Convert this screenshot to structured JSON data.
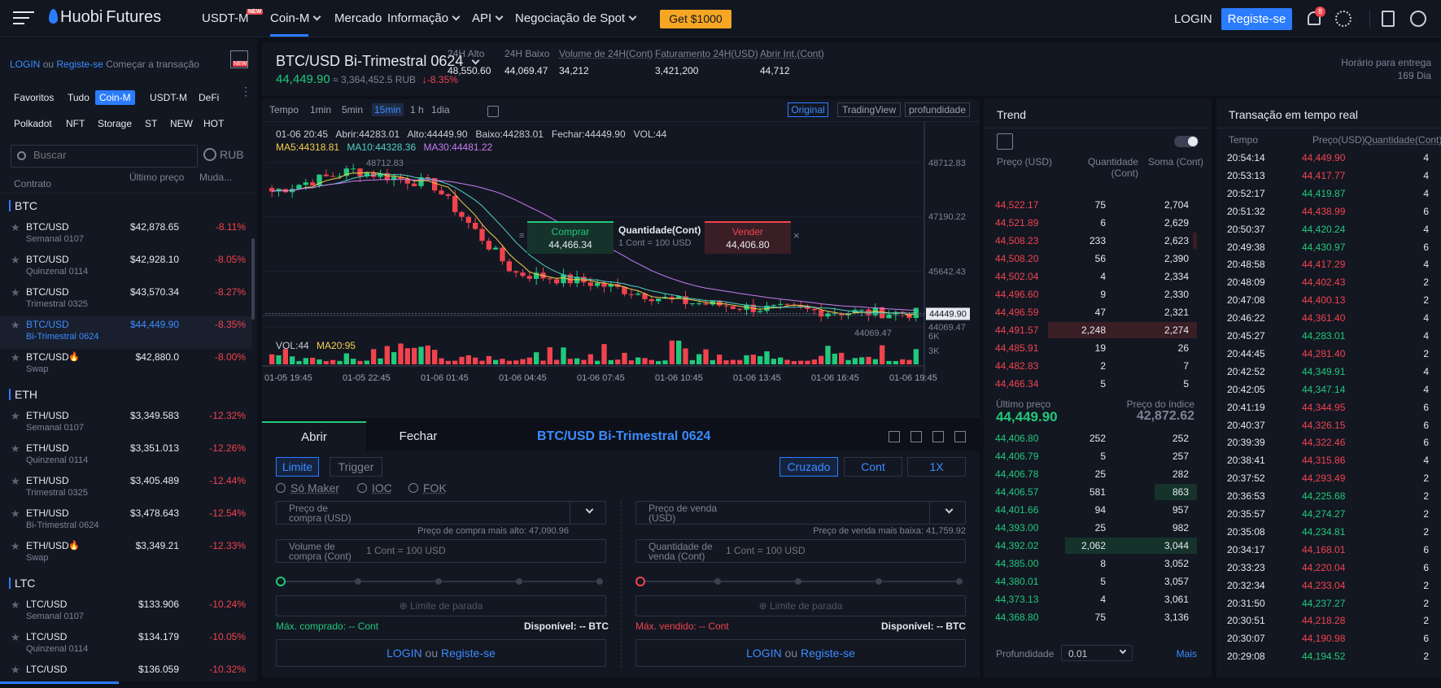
{
  "brand": {
    "logo_huobi": "Huobi",
    "logo_futures": "Futures"
  },
  "nav": {
    "usdt_m": "USDT-M",
    "new_tag": "NEW",
    "coin_m": "Coin-M",
    "mercado": "Mercado",
    "informacao": "Informação",
    "api": "API",
    "spot": "Negociação de Spot",
    "promo": "Get $1000",
    "login": "LOGIN",
    "register": "Registe-se",
    "notif_count": "8"
  },
  "left": {
    "login_link": "LOGIN",
    "or": "ou",
    "register_link": "Registe-se",
    "start": "Começar a transação",
    "new_badge": "NEW",
    "tabs1": [
      "Favoritos",
      "Tudo",
      "Coin-M",
      "USDT-M",
      "DeFi"
    ],
    "tabs2": [
      "Polkadot",
      "NFT",
      "Storage",
      "ST",
      "NEW",
      "HOT"
    ],
    "search_placeholder": "Buscar",
    "currency": "RUB",
    "col_price": "Último preço",
    "col_change": "Muda...",
    "col_contract": "Contrato",
    "groups": [
      {
        "name": "BTC",
        "rows": [
          {
            "n1": "BTC/USD",
            "n2": "Semanal 0107",
            "price": "$42,878.65",
            "change": "-8.11%"
          },
          {
            "n1": "BTC/USD",
            "n2": "Quinzenal 0114",
            "price": "$42,928.10",
            "change": "-8.05%"
          },
          {
            "n1": "BTC/USD",
            "n2": "Trimestral 0325",
            "price": "$43,570.34",
            "change": "-8.27%"
          },
          {
            "n1": "BTC/USD",
            "n2": "Bi-Trimestral 0624",
            "price": "$44,449.90",
            "change": "-8.35%"
          },
          {
            "n1": "BTC/USD",
            "n2": "Swap",
            "price": "$42,880.0",
            "change": "-8.00%"
          }
        ]
      },
      {
        "name": "ETH",
        "rows": [
          {
            "n1": "ETH/USD",
            "n2": "Semanal 0107",
            "price": "$3,349.583",
            "change": "-12.32%"
          },
          {
            "n1": "ETH/USD",
            "n2": "Quinzenal 0114",
            "price": "$3,351.013",
            "change": "-12.26%"
          },
          {
            "n1": "ETH/USD",
            "n2": "Trimestral 0325",
            "price": "$3,405.489",
            "change": "-12.44%"
          },
          {
            "n1": "ETH/USD",
            "n2": "Bi-Trimestral 0624",
            "price": "$3,478.643",
            "change": "-12.54%"
          },
          {
            "n1": "ETH/USD",
            "n2": "Swap",
            "price": "$3,349.21",
            "change": "-12.33%"
          }
        ]
      },
      {
        "name": "LTC",
        "rows": [
          {
            "n1": "LTC/USD",
            "n2": "Semanal 0107",
            "price": "$133.906",
            "change": "-10.24%"
          },
          {
            "n1": "LTC/USD",
            "n2": "Quinzenal 0114",
            "price": "$134.179",
            "change": "-10.05%"
          },
          {
            "n1": "LTC/USD",
            "n2": "",
            "price": "$136.059",
            "change": "-10.32%"
          }
        ]
      }
    ]
  },
  "header": {
    "symbol": "BTC/USD Bi-Trimestral 0624",
    "price": "44,449.90",
    "rub": "≈ 3,364,452.5 RUB",
    "change": "-8.35%",
    "stats": [
      {
        "label": "24H Alto",
        "value": "48,550.60"
      },
      {
        "label": "24H Baixo",
        "value": "44,069.47"
      },
      {
        "label": "Volume de 24H(Cont)",
        "value": "34,212"
      },
      {
        "label": "Faturamento 24H(USD)",
        "value": "3,421,200"
      },
      {
        "label": "Abrir Int.(Cont)",
        "value": "44,712"
      }
    ],
    "delivery_label": "Horário para entrega",
    "delivery_value": "169 Dia"
  },
  "chart": {
    "intervals": [
      "Tempo",
      "1min",
      "5min",
      "15min",
      "1 h",
      "1dia"
    ],
    "views": [
      "Original",
      "TradingView",
      "profundidade"
    ],
    "ohlc": "01-06 20:45   Abrir:44283.01   Alto:44449.90   Baixo:44283.01   Fechar:44449.90   VOL:44",
    "ma5": "MA5:44318.81",
    "ma10": "MA10:44328.36",
    "ma30": "MA30:44481.22",
    "yticks": [
      "48712.83",
      "47190.22",
      "45642.43",
      "44069.47"
    ],
    "last_label": "44449.90",
    "high_label": "48712.83",
    "low_label": "44069.47",
    "vol_label": "VOL:44",
    "vol_ma": "MA20:95",
    "vol_ticks": [
      "6K",
      "3K"
    ],
    "xticks": [
      "01-05 19:45",
      "01-05 22:45",
      "01-06 01:45",
      "01-06 04:45",
      "01-06 07:45",
      "01-06 10:45",
      "01-06 13:45",
      "01-06 16:45",
      "01-06 19:45"
    ],
    "popup": {
      "buy": "Comprar",
      "buy_price": "44,466.34",
      "qty": "Quantidade(Cont)",
      "qty_sub": "1 Cont = 100 USD",
      "sell": "Vender",
      "sell_price": "44,406.80"
    }
  },
  "chart_data": {
    "type": "candlestick",
    "x": [
      "01-05 19:45",
      "01-05 22:45",
      "01-06 01:45",
      "01-06 04:45",
      "01-06 07:45",
      "01-06 10:45",
      "01-06 13:45",
      "01-06 16:45",
      "01-06 19:45"
    ],
    "close": [
      47900,
      48500,
      48100,
      45600,
      45300,
      44800,
      44600,
      44500,
      44449.9
    ],
    "ylim": [
      44069.47,
      48712.83
    ],
    "volume_ticks": [
      "6K",
      "3K"
    ]
  },
  "order": {
    "tab_open": "Abrir",
    "tab_close": "Fechar",
    "symbol": "BTC/USD Bi-Trimestral 0624",
    "limit": "Limite",
    "trigger": "Trigger",
    "cross": "Cruzado",
    "cont": "Cont",
    "lev": "1X",
    "opts": [
      "Só Maker",
      "IOC",
      "FOK"
    ],
    "buy_price_label": "Preço de compra (USD)",
    "sell_price_label": "Preço de venda (USD)",
    "buy_hint": "Preço de compra mais alto: 47,090.96",
    "sell_hint": "Preço de venda mais baixa: 41,759.92",
    "buy_vol_label": "Volume de compra (Cont)",
    "sell_vol_label": "Quantidade de venda (Cont)",
    "cont_ph": "1 Cont = 100 USD",
    "stop": "Limite de parada",
    "max_buy": "Máx. comprado: -- Cont",
    "max_sell": "Máx. vendido: -- Cont",
    "avail": "Disponível: -- BTC",
    "login": "LOGIN",
    "or": "ou",
    "register": "Registe-se"
  },
  "book": {
    "title": "Trend",
    "col_price": "Preço (USD)",
    "col_qty": "Quantidade (Cont)",
    "col_sum": "Soma (Cont)",
    "asks": [
      {
        "p": "44,522.17",
        "q": "75",
        "s": "2,704",
        "w": 0
      },
      {
        "p": "44,521.89",
        "q": "6",
        "s": "2,629",
        "w": 0
      },
      {
        "p": "44,508.23",
        "q": "233",
        "s": "2,623",
        "w": 0.02
      },
      {
        "p": "44,508.20",
        "q": "56",
        "s": "2,390",
        "w": 0
      },
      {
        "p": "44,502.04",
        "q": "4",
        "s": "2,334",
        "w": 0
      },
      {
        "p": "44,496.60",
        "q": "9",
        "s": "2,330",
        "w": 0
      },
      {
        "p": "44,496.59",
        "q": "47",
        "s": "2,321",
        "w": 0
      },
      {
        "p": "44,491.57",
        "q": "2,248",
        "s": "2,274",
        "w": 0.7
      },
      {
        "p": "44,485.91",
        "q": "19",
        "s": "26",
        "w": 0
      },
      {
        "p": "44,482.83",
        "q": "2",
        "s": "7",
        "w": 0
      },
      {
        "p": "44,466.34",
        "q": "5",
        "s": "5",
        "w": 0
      }
    ],
    "last_label": "Último preço",
    "last": "44,449.90",
    "index_label": "Preço do índice",
    "index": "42,872.62",
    "bids": [
      {
        "p": "44,406.80",
        "q": "252",
        "s": "252",
        "w": 0
      },
      {
        "p": "44,406.79",
        "q": "5",
        "s": "257",
        "w": 0
      },
      {
        "p": "44,406.78",
        "q": "25",
        "s": "282",
        "w": 0
      },
      {
        "p": "44,406.57",
        "q": "581",
        "s": "863",
        "w": 0.2
      },
      {
        "p": "44,401.66",
        "q": "94",
        "s": "957",
        "w": 0
      },
      {
        "p": "44,393.00",
        "q": "25",
        "s": "982",
        "w": 0
      },
      {
        "p": "44,392.02",
        "q": "2,062",
        "s": "3,044",
        "w": 0.62
      },
      {
        "p": "44,385.00",
        "q": "8",
        "s": "3,052",
        "w": 0
      },
      {
        "p": "44,380.01",
        "q": "5",
        "s": "3,057",
        "w": 0
      },
      {
        "p": "44,373.13",
        "q": "4",
        "s": "3,061",
        "w": 0
      },
      {
        "p": "44,368.80",
        "q": "75",
        "s": "3,136",
        "w": 0
      }
    ],
    "depth_label": "Profundidade",
    "depth_value": "0.01",
    "more": "Mais"
  },
  "trades": {
    "title": "Transação em tempo real",
    "col_time": "Tempo",
    "col_price": "Preço(USD)",
    "col_qty": "Quantidade(Cont)",
    "rows": [
      {
        "t": "20:54:14",
        "p": "44,449.90",
        "q": "4",
        "side": "sell"
      },
      {
        "t": "20:53:13",
        "p": "44,417.77",
        "q": "4",
        "side": "sell"
      },
      {
        "t": "20:52:17",
        "p": "44,419.87",
        "q": "4",
        "side": "buy"
      },
      {
        "t": "20:51:32",
        "p": "44,438.99",
        "q": "6",
        "side": "sell"
      },
      {
        "t": "20:50:37",
        "p": "44,420.24",
        "q": "4",
        "side": "buy"
      },
      {
        "t": "20:49:38",
        "p": "44,430.97",
        "q": "6",
        "side": "buy"
      },
      {
        "t": "20:48:58",
        "p": "44,417.29",
        "q": "4",
        "side": "sell"
      },
      {
        "t": "20:48:09",
        "p": "44,402.43",
        "q": "2",
        "side": "sell"
      },
      {
        "t": "20:47:08",
        "p": "44,400.13",
        "q": "2",
        "side": "sell"
      },
      {
        "t": "20:46:22",
        "p": "44,361.40",
        "q": "4",
        "side": "sell"
      },
      {
        "t": "20:45:27",
        "p": "44,283.01",
        "q": "4",
        "side": "buy"
      },
      {
        "t": "20:44:45",
        "p": "44,281.40",
        "q": "2",
        "side": "sell"
      },
      {
        "t": "20:42:52",
        "p": "44,349.91",
        "q": "4",
        "side": "buy"
      },
      {
        "t": "20:42:05",
        "p": "44,347.14",
        "q": "4",
        "side": "buy"
      },
      {
        "t": "20:41:19",
        "p": "44,344.95",
        "q": "6",
        "side": "sell"
      },
      {
        "t": "20:40:37",
        "p": "44,326.15",
        "q": "6",
        "side": "sell"
      },
      {
        "t": "20:39:39",
        "p": "44,322.46",
        "q": "6",
        "side": "sell"
      },
      {
        "t": "20:38:41",
        "p": "44,315.86",
        "q": "4",
        "side": "sell"
      },
      {
        "t": "20:37:52",
        "p": "44,293.49",
        "q": "2",
        "side": "sell"
      },
      {
        "t": "20:36:53",
        "p": "44,225.68",
        "q": "2",
        "side": "buy"
      },
      {
        "t": "20:35:57",
        "p": "44,274.27",
        "q": "2",
        "side": "buy"
      },
      {
        "t": "20:35:08",
        "p": "44,234.81",
        "q": "2",
        "side": "buy"
      },
      {
        "t": "20:34:17",
        "p": "44,168.01",
        "q": "6",
        "side": "sell"
      },
      {
        "t": "20:33:23",
        "p": "44,220.04",
        "q": "6",
        "side": "sell"
      },
      {
        "t": "20:32:34",
        "p": "44,233.04",
        "q": "2",
        "side": "sell"
      },
      {
        "t": "20:31:50",
        "p": "44,237.27",
        "q": "2",
        "side": "buy"
      },
      {
        "t": "20:30:51",
        "p": "44,218.28",
        "q": "2",
        "side": "sell"
      },
      {
        "t": "20:30:07",
        "p": "44,190.98",
        "q": "6",
        "side": "sell"
      },
      {
        "t": "20:29:08",
        "p": "44,194.52",
        "q": "2",
        "side": "buy"
      }
    ]
  },
  "colors": {
    "red": "#f0434e",
    "green": "#20c97b",
    "accent": "#2b7cff",
    "promo": "#f5a623"
  }
}
